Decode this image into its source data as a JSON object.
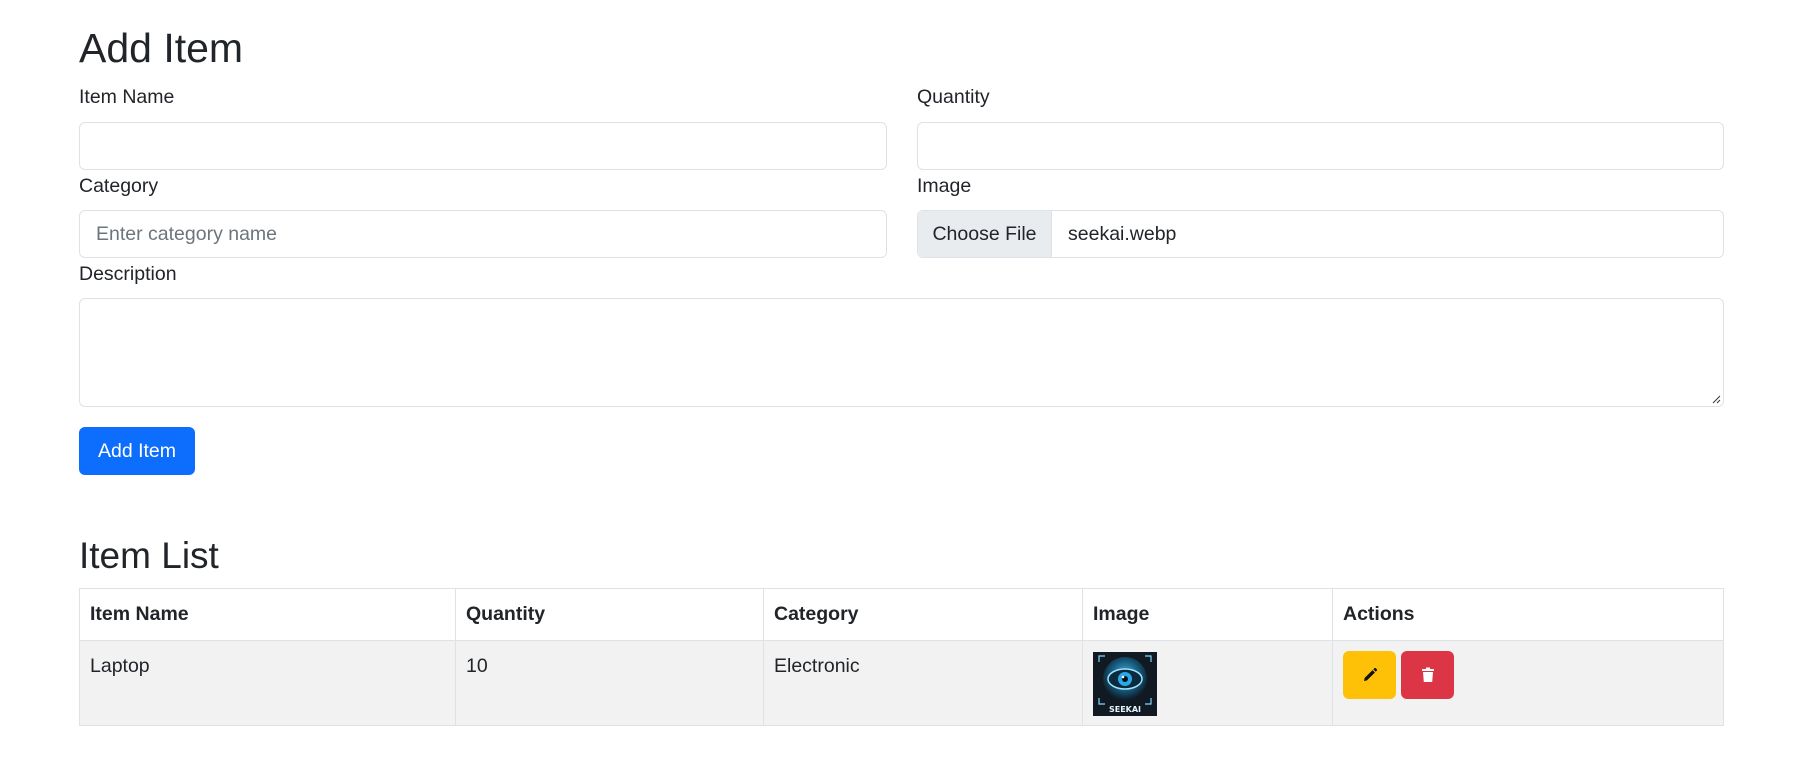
{
  "form": {
    "title": "Add Item",
    "item_name_label": "Item Name",
    "quantity_label": "Quantity",
    "category_label": "Category",
    "category_placeholder": "Enter category name",
    "image_label": "Image",
    "choose_file_label": "Choose File",
    "selected_file": "seekai.webp",
    "description_label": "Description",
    "submit_label": "Add Item"
  },
  "list": {
    "title": "Item List",
    "columns": [
      "Item Name",
      "Quantity",
      "Category",
      "Image",
      "Actions"
    ],
    "rows": [
      {
        "name": "Laptop",
        "quantity": "10",
        "category": "Electronic",
        "image_caption": "SEEKAI"
      }
    ]
  },
  "colors": {
    "primary": "#0d6efd",
    "warning": "#ffc107",
    "danger": "#dc3545"
  },
  "icons": {
    "edit": "pencil-icon",
    "delete": "trash-icon"
  }
}
